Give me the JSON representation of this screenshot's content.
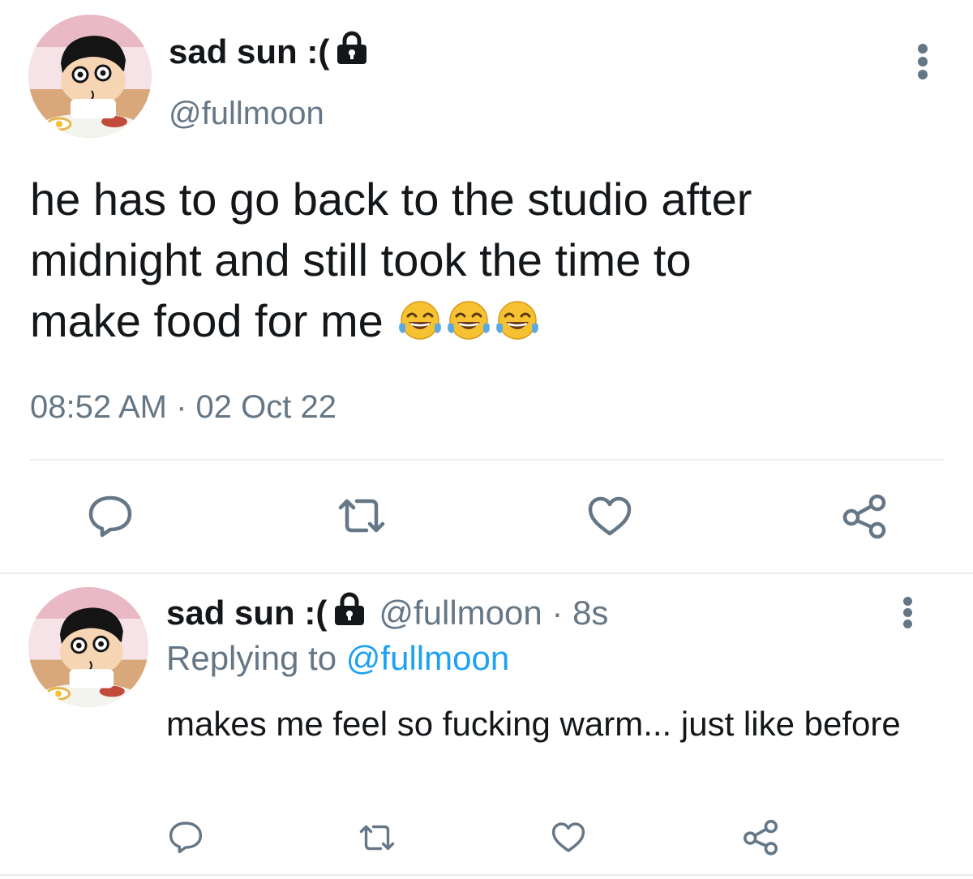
{
  "tweet": {
    "display_name": "sad sun :(",
    "handle": "@fullmoon",
    "text": "he has to go back to the studio after\nmidnight and still took the time to\nmake food for me",
    "emoji": [
      "😂",
      "😂",
      "😂"
    ],
    "timestamp": "08:52 AM · 02 Oct 22",
    "actions": [
      "reply-icon",
      "retweet-icon",
      "like-icon",
      "share-icon"
    ]
  },
  "reply": {
    "display_name": "sad sun :(",
    "meta": "@fullmoon · 8s",
    "replying_prefix": "Replying to",
    "replying_handle": "@fullmoon",
    "text": "makes me feel so fucking warm... just like before",
    "actions": [
      "reply-icon",
      "retweet-icon",
      "like-icon",
      "share-icon"
    ]
  },
  "colors": {
    "text": "#14171a",
    "secondary": "#657786",
    "link": "#1da1f2",
    "divider": "#e6ecf0"
  }
}
